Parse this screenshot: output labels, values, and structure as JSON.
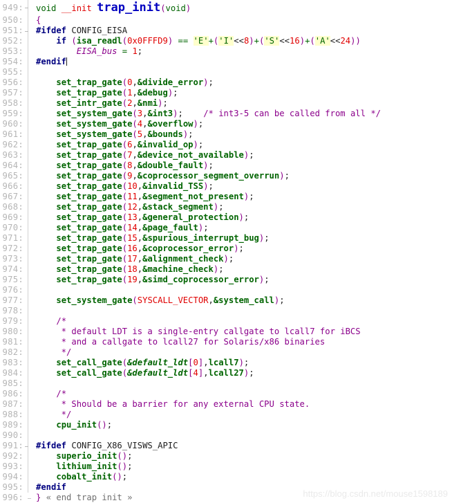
{
  "editor": {
    "title": "trap_init",
    "language": "C",
    "first_line": 949,
    "last_line": 996,
    "colors": {
      "background": "#ffffff",
      "line_number": "#b5b5b5",
      "keyword": "#000080",
      "function": "#006400",
      "number": "#e00000",
      "comment": "#8b008b",
      "paren": "#8b008b",
      "char_literal_bg": "#ffffcc",
      "declared_function": "#0000c0",
      "fold_bar": "#d2d2d2"
    }
  },
  "watermark": {
    "text": "https://blog.csdn.net/mouse1598189"
  },
  "lines": [
    {
      "n": "949",
      "text": "void __init trap_init(void)"
    },
    {
      "n": "950",
      "text": "{"
    },
    {
      "n": "951",
      "text": "#ifdef CONFIG_EISA"
    },
    {
      "n": "952",
      "text": "    if (isa_readl(0x0FFFD9) == 'E'+('I'<<8)+('S'<<16)+('A'<<24))"
    },
    {
      "n": "953",
      "text": "        EISA_bus = 1;"
    },
    {
      "n": "954",
      "text": "#endif"
    },
    {
      "n": "955",
      "text": ""
    },
    {
      "n": "956",
      "text": "    set_trap_gate(0,&divide_error);"
    },
    {
      "n": "957",
      "text": "    set_trap_gate(1,&debug);"
    },
    {
      "n": "958",
      "text": "    set_intr_gate(2,&nmi);"
    },
    {
      "n": "959",
      "text": "    set_system_gate(3,&int3);    /* int3-5 can be called from all */"
    },
    {
      "n": "960",
      "text": "    set_system_gate(4,&overflow);"
    },
    {
      "n": "961",
      "text": "    set_system_gate(5,&bounds);"
    },
    {
      "n": "962",
      "text": "    set_trap_gate(6,&invalid_op);"
    },
    {
      "n": "963",
      "text": "    set_trap_gate(7,&device_not_available);"
    },
    {
      "n": "964",
      "text": "    set_trap_gate(8,&double_fault);"
    },
    {
      "n": "965",
      "text": "    set_trap_gate(9,&coprocessor_segment_overrun);"
    },
    {
      "n": "966",
      "text": "    set_trap_gate(10,&invalid_TSS);"
    },
    {
      "n": "967",
      "text": "    set_trap_gate(11,&segment_not_present);"
    },
    {
      "n": "968",
      "text": "    set_trap_gate(12,&stack_segment);"
    },
    {
      "n": "969",
      "text": "    set_trap_gate(13,&general_protection);"
    },
    {
      "n": "970",
      "text": "    set_trap_gate(14,&page_fault);"
    },
    {
      "n": "971",
      "text": "    set_trap_gate(15,&spurious_interrupt_bug);"
    },
    {
      "n": "972",
      "text": "    set_trap_gate(16,&coprocessor_error);"
    },
    {
      "n": "973",
      "text": "    set_trap_gate(17,&alignment_check);"
    },
    {
      "n": "974",
      "text": "    set_trap_gate(18,&machine_check);"
    },
    {
      "n": "975",
      "text": "    set_trap_gate(19,&simd_coprocessor_error);"
    },
    {
      "n": "976",
      "text": ""
    },
    {
      "n": "977",
      "text": "    set_system_gate(SYSCALL_VECTOR,&system_call);"
    },
    {
      "n": "978",
      "text": ""
    },
    {
      "n": "979",
      "text": "    /*"
    },
    {
      "n": "980",
      "text": "     * default LDT is a single-entry callgate to lcall7 for iBCS"
    },
    {
      "n": "981",
      "text": "     * and a callgate to lcall27 for Solaris/x86 binaries"
    },
    {
      "n": "982",
      "text": "     */"
    },
    {
      "n": "983",
      "text": "    set_call_gate(&default_ldt[0],lcall7);"
    },
    {
      "n": "984",
      "text": "    set_call_gate(&default_ldt[4],lcall27);"
    },
    {
      "n": "985",
      "text": ""
    },
    {
      "n": "986",
      "text": "    /*"
    },
    {
      "n": "987",
      "text": "     * Should be a barrier for any external CPU state."
    },
    {
      "n": "988",
      "text": "     */"
    },
    {
      "n": "989",
      "text": "    cpu_init();"
    },
    {
      "n": "990",
      "text": ""
    },
    {
      "n": "991",
      "text": "#ifdef CONFIG_X86_VISWS_APIC"
    },
    {
      "n": "992",
      "text": "    superio_init();"
    },
    {
      "n": "993",
      "text": "    lithium_init();"
    },
    {
      "n": "994",
      "text": "    cobalt_init();"
    },
    {
      "n": "995",
      "text": "#endif"
    },
    {
      "n": "996",
      "text": "} « end trap init »"
    }
  ]
}
